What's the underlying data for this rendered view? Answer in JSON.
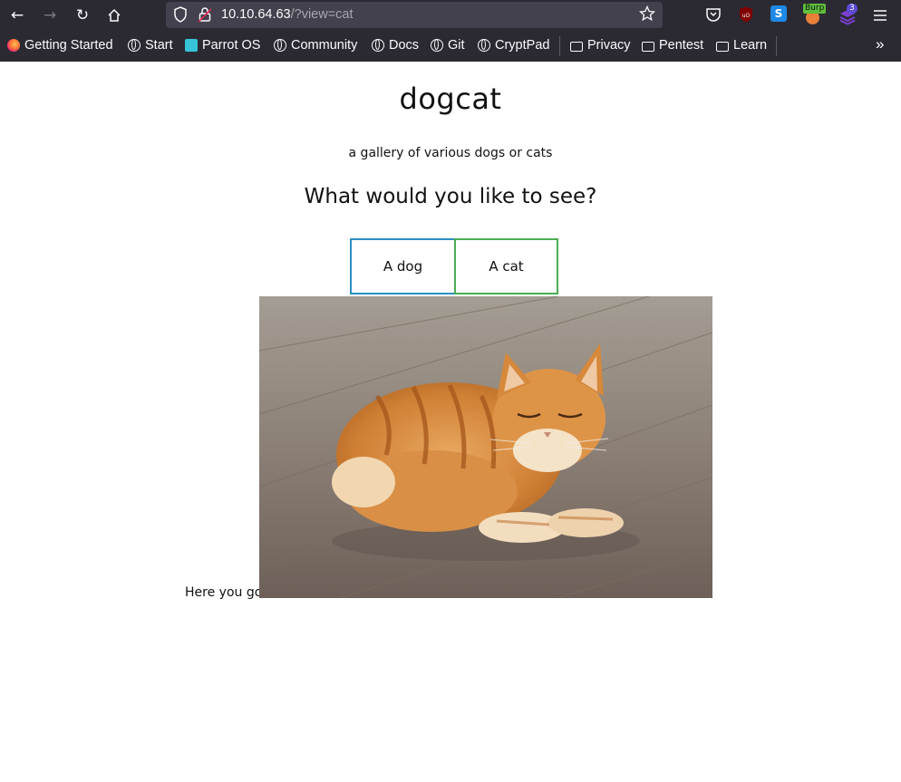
{
  "browser": {
    "url_host": "10.10.64.63",
    "url_path": "/?view=cat",
    "burp_label": "Burp",
    "ext_badge": "3",
    "bookmarks": [
      "Getting Started",
      "Start",
      "Parrot OS",
      "Community",
      "Docs",
      "Git",
      "CryptPad",
      "Privacy",
      "Pentest",
      "Learn"
    ]
  },
  "page": {
    "title": "dogcat",
    "subtitle": "a gallery of various dogs or cats",
    "question": "What would you like to see?",
    "dog_button": "A dog",
    "cat_button": "A cat",
    "result_text": "Here you go!"
  }
}
